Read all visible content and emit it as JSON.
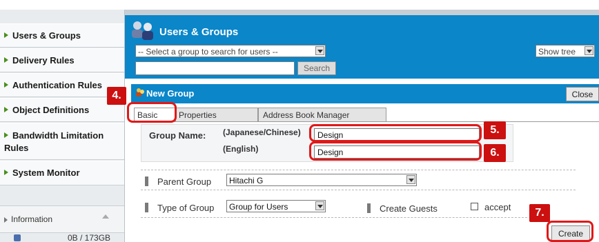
{
  "sidebar": {
    "items": [
      {
        "label": "Users & Groups"
      },
      {
        "label": "Delivery Rules"
      },
      {
        "label": "Authentication Rules"
      },
      {
        "label": "Object Definitions"
      },
      {
        "label": "Bandwidth Limitation",
        "label2": "Rules"
      },
      {
        "label": "System Monitor"
      }
    ],
    "info": {
      "label": "Information",
      "usage": "0B / 173GB"
    }
  },
  "header": {
    "title": "Users & Groups",
    "group_select": "-- Select a group to search for users --",
    "search_value": "",
    "search_button": "Search",
    "view_select": "Show tree"
  },
  "new_group": {
    "title": "New Group",
    "close_button": "Close",
    "tabs": [
      "Basic",
      "Properties",
      "Address Book Manager"
    ],
    "group_name_label": "Group Name:",
    "japanese_label": "(Japanese/Chinese)",
    "english_label": "(English)",
    "name_japanese": "Design",
    "name_english": "Design",
    "parent_group_label": "Parent Group",
    "parent_group_value": "Hitachi G",
    "type_label": "Type of Group",
    "type_value": "Group for Users",
    "create_guests_label": "Create Guests",
    "accept_label": "accept",
    "accept_checked": false,
    "create_button": "Create"
  },
  "callouts": {
    "step4": "4.",
    "step5": "5.",
    "step6": "6.",
    "step7": "7."
  },
  "colors": {
    "header_blue": "#0a86c9",
    "callout_red": "#cc1010",
    "highlight_red": "#e01818",
    "nav_arrow": "#4a8f1e"
  }
}
